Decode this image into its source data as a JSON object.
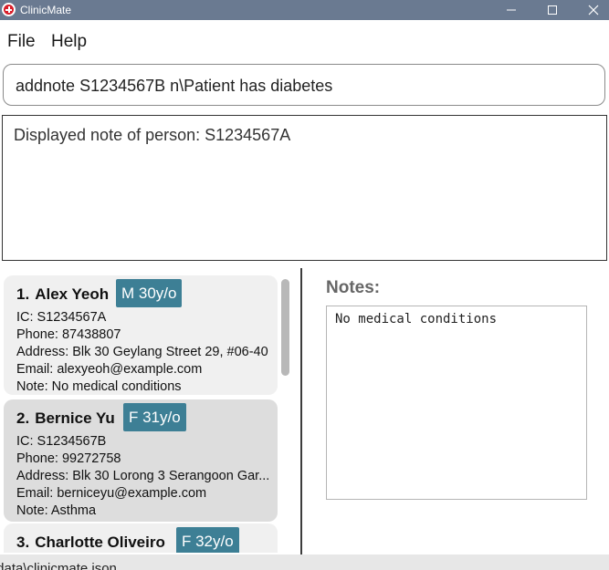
{
  "window": {
    "title": "ClinicMate",
    "controls": {
      "minimize": "minimize",
      "maximize": "maximize",
      "close": "close"
    }
  },
  "menu": {
    "file": "File",
    "help": "Help"
  },
  "command": {
    "value": "addnote S1234567B n\\Patient has diabetes"
  },
  "result": {
    "text": "Displayed note of person: S1234567A"
  },
  "persons": [
    {
      "index": "1.",
      "name": "Alex Yeoh",
      "badge": "M 30y/o",
      "ic": "IC: S1234567A",
      "phone": "Phone: 87438807",
      "address": "Address: Blk 30 Geylang Street 29, #06-40",
      "email": "Email: alexyeoh@example.com",
      "note": "Note: No medical conditions"
    },
    {
      "index": "2.",
      "name": "Bernice Yu",
      "badge": "F 31y/o",
      "ic": "IC: S1234567B",
      "phone": "Phone: 99272758",
      "address": "Address: Blk 30 Lorong 3 Serangoon Gar...",
      "email": "Email: berniceyu@example.com",
      "note": "Note: Asthma"
    },
    {
      "index": "3.",
      "name": "Charlotte Oliveiro",
      "badge": "F 32y/o"
    }
  ],
  "notes_panel": {
    "heading": "Notes:",
    "content": "No medical conditions"
  },
  "status": {
    "path": "\\data\\clinicmate.json"
  },
  "colors": {
    "titlebar": "#6a7a91",
    "badge": "#3d7f95",
    "selected_card": "#dddddd",
    "card": "#f0f0f0"
  }
}
